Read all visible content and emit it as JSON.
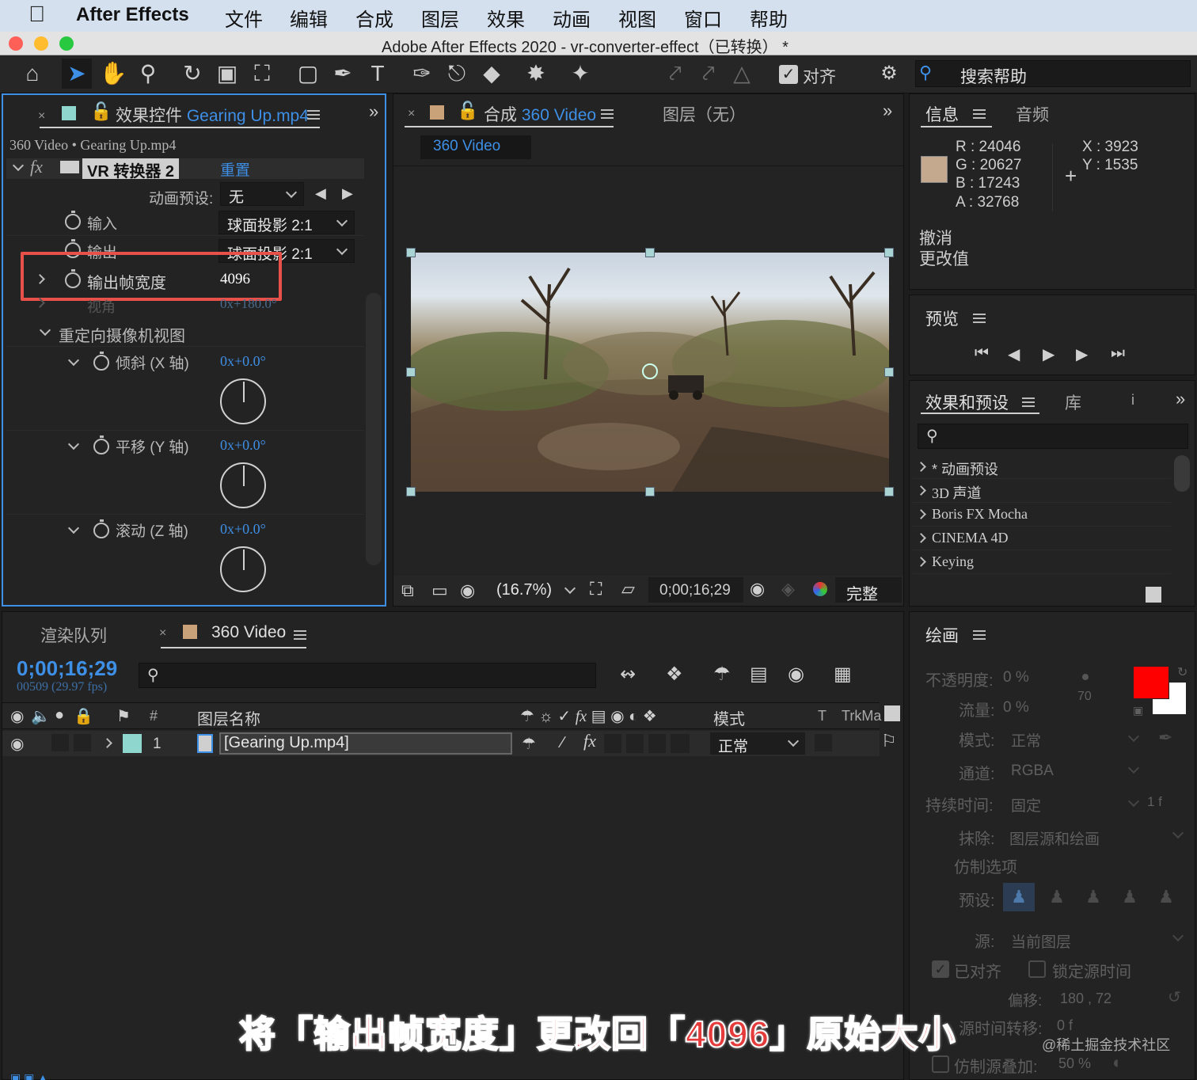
{
  "menubar": {
    "app_name": "After Effects",
    "items": [
      "文件",
      "编辑",
      "合成",
      "图层",
      "效果",
      "动画",
      "视图",
      "窗口",
      "帮助"
    ]
  },
  "titlebar": {
    "title": "Adobe After Effects 2020 - vr-converter-effect（已转换） *"
  },
  "toolbar": {
    "snap_label": "对齐",
    "search_help": "搜索帮助"
  },
  "effects_panel": {
    "tab_prefix": "效果控件",
    "tab_file": "Gearing Up.mp4",
    "breadcrumb": "360 Video • Gearing Up.mp4",
    "effect_name": "VR 转换器 2",
    "reset_label": "重置",
    "preset_label": "动画预设:",
    "preset_value": "无",
    "rows": {
      "input_label": "输入",
      "input_value": "球面投影 2:1",
      "output_label": "输出",
      "output_value": "球面投影 2:1",
      "frame_width_label": "输出帧宽度",
      "frame_width_value": "4096",
      "fov_label": "视角",
      "fov_value": "0x+180.0°",
      "reorient_label": "重定向摄像机视图",
      "tilt_label": "倾斜 (X 轴)",
      "tilt_value": "0x+0.0°",
      "pan_label": "平移 (Y 轴)",
      "pan_value": "0x+0.0°",
      "roll_label": "滚动 (Z 轴)",
      "roll_value": "0x+0.0°"
    }
  },
  "comp_panel": {
    "tab_prefix": "合成",
    "tab_name": "360 Video",
    "layer_tab": "图层（无）",
    "sub_tab": "360 Video",
    "zoom": "(16.7%)",
    "timecode": "0;00;16;29",
    "quality": "完整"
  },
  "info_panel": {
    "tab_info": "信息",
    "tab_audio": "音频",
    "r": "R :  24046",
    "g": "G :  20627",
    "b": "B :  17243",
    "a": "A :  32768",
    "x": "X :  3923",
    "y": "Y :  1535",
    "undo": "撤消",
    "change": "更改值",
    "sample_color": "#c4a98f"
  },
  "preview_panel": {
    "title": "预览"
  },
  "effects_presets": {
    "title": "效果和预设",
    "library": "库",
    "items": [
      "* 动画预设",
      "3D 声道",
      "Boris FX Mocha",
      "CINEMA 4D",
      "Keying"
    ]
  },
  "timeline": {
    "tab_render": "渲染队列",
    "tab_comp": "360 Video",
    "timecode": "0;00;16;29",
    "frame_info": "00509 (29.97 fps)",
    "col_hash": "#",
    "col_layer_name": "图层名称",
    "col_mode": "模式",
    "col_t": "T",
    "col_trkmat": "TrkMa",
    "layer_index": "1",
    "layer_name": "[Gearing Up.mp4]",
    "layer_mode": "正常"
  },
  "paint_panel": {
    "title": "绘画",
    "opacity": "不透明度:",
    "opacity_value": "0 %",
    "flow": "流量:",
    "flow_value": "0 %",
    "brush_size": "70",
    "mode_label": "模式:",
    "mode_value": "正常",
    "channel_label": "通道:",
    "channel_value": "RGBA",
    "duration_label": "持续时间:",
    "duration_value": "固定",
    "duration_frames": "1  f",
    "erase_label": "抹除:",
    "erase_value": "图层源和绘画",
    "clone_options": "仿制选项",
    "preset_label": "预设:",
    "source_label": "源:",
    "source_value": "当前图层",
    "aligned": "已对齐",
    "lock_time": "锁定源时间",
    "offset_label": "偏移:",
    "offset_value": "180 ,    72",
    "time_shift": "源时间转移:",
    "time_shift_value": "0  f",
    "overlay": "仿制源叠加:",
    "overlay_value": "50 %",
    "fg_color": "#ff0000",
    "bg_color": "#ffffff"
  },
  "caption": "将「输出帧宽度」更改回「4096」原始大小",
  "watermark": "@稀土掘金技术社区"
}
